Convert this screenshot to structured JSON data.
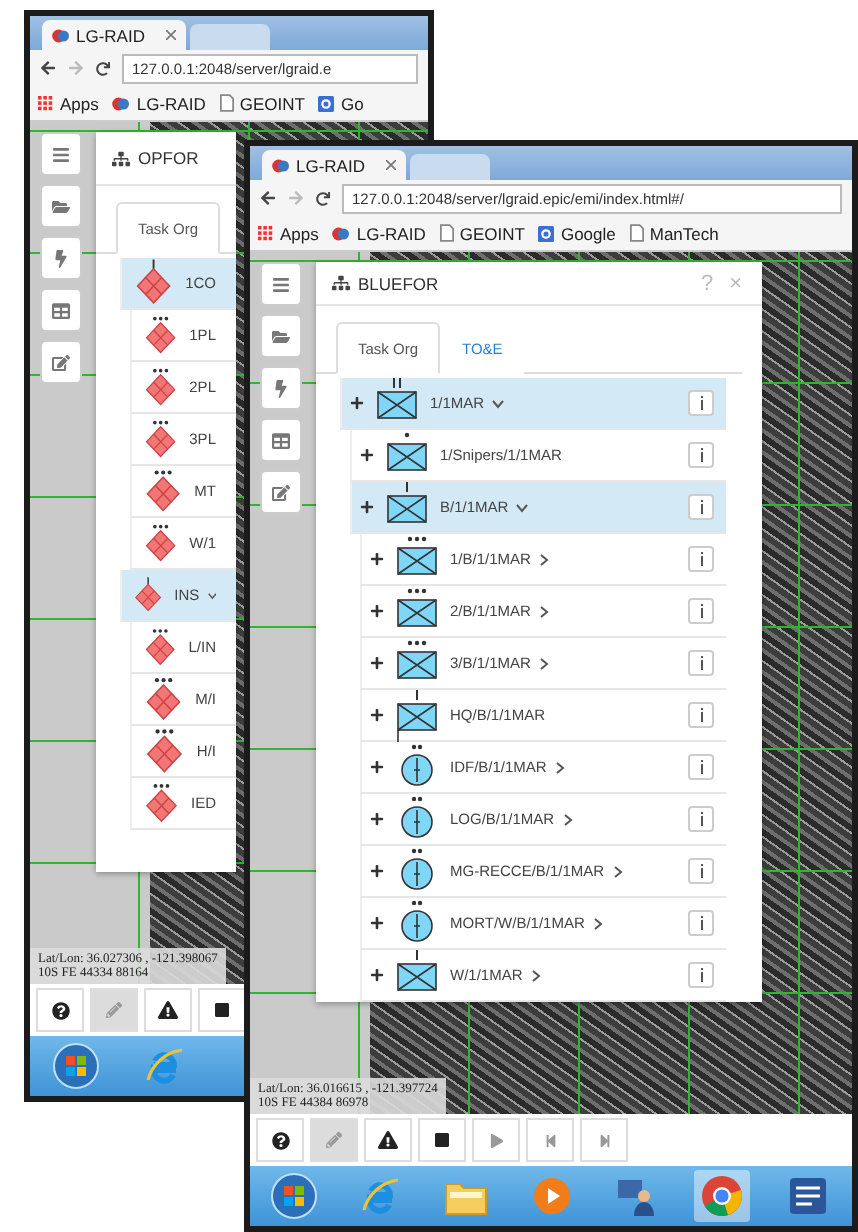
{
  "windows": [
    {
      "tab_title": "LG-RAID",
      "url": "127.0.0.1:2048/server/lgraid.e",
      "bookmarks": [
        {
          "label": "Apps",
          "kind": "apps"
        },
        {
          "label": "LG-RAID",
          "kind": "logo"
        },
        {
          "label": "GEOINT",
          "kind": "page"
        },
        {
          "label": "Go",
          "kind": "google"
        }
      ],
      "side_tools": [
        {
          "kind": "menu"
        },
        {
          "kind": "folder"
        },
        {
          "kind": "lightning"
        },
        {
          "kind": "table"
        },
        {
          "kind": "edit"
        }
      ],
      "panel": {
        "title": "OPFOR",
        "tabs": [
          {
            "label": "Task Org",
            "selected": true
          }
        ],
        "tree": [
          {
            "label": "1CO",
            "kind": "hostile-company",
            "expanded": true,
            "has_children": false,
            "children": [
              {
                "label": "1PL",
                "kind": "hostile-platoon",
                "expanded": false,
                "has_children": false
              },
              {
                "label": "2PL",
                "kind": "hostile-platoon",
                "expanded": false,
                "has_children": false
              },
              {
                "label": "3PL",
                "kind": "hostile-platoon",
                "expanded": false,
                "has_children": false
              },
              {
                "label": "MT",
                "kind": "hostile-platoon",
                "expanded": false,
                "has_children": false
              },
              {
                "label": "W/1",
                "kind": "hostile-platoon",
                "expanded": false,
                "has_children": false
              }
            ]
          },
          {
            "label": "INS",
            "kind": "hostile-company",
            "expanded": true,
            "has_children": true,
            "children": [
              {
                "label": "L/IN",
                "kind": "hostile-platoon",
                "expanded": false,
                "has_children": false
              },
              {
                "label": "M/I",
                "kind": "hostile-platoon",
                "expanded": false,
                "has_children": false
              },
              {
                "label": "H/I",
                "kind": "hostile-platoon",
                "expanded": false,
                "has_children": false
              },
              {
                "label": "IED",
                "kind": "hostile-platoon",
                "expanded": false,
                "has_children": false
              }
            ]
          }
        ]
      },
      "coordinates": [
        "Lat/Lon: 36.027306 , -121.398067",
        "10S FE 44334 88164"
      ],
      "tools": [
        {
          "kind": "help",
          "pressed": false
        },
        {
          "kind": "pencil",
          "pressed": true
        },
        {
          "kind": "warning",
          "pressed": false
        },
        {
          "kind": "stop",
          "pressed": false
        }
      ],
      "taskbar": [
        {
          "kind": "start",
          "active": false
        },
        {
          "kind": "ie",
          "active": false
        }
      ]
    },
    {
      "tab_title": "LG-RAID",
      "url": "127.0.0.1:2048/server/lgraid.epic/emi/index.html#/",
      "bookmarks": [
        {
          "label": "Apps",
          "kind": "apps"
        },
        {
          "label": "LG-RAID",
          "kind": "logo"
        },
        {
          "label": "GEOINT",
          "kind": "page"
        },
        {
          "label": "Google",
          "kind": "google"
        },
        {
          "label": "ManTech",
          "kind": "page"
        }
      ],
      "side_tools": [
        {
          "kind": "menu"
        },
        {
          "kind": "folder"
        },
        {
          "kind": "lightning"
        },
        {
          "kind": "table"
        },
        {
          "kind": "edit"
        }
      ],
      "panel": {
        "title": "BLUEFOR",
        "help": "?",
        "close": "×",
        "tabs": [
          {
            "label": "Task Org",
            "selected": true
          },
          {
            "label": "TO&E",
            "selected": false
          }
        ],
        "tree": [
          {
            "label": "1/1MAR",
            "kind": "infantry-battalion",
            "expanded": true,
            "has_children": true,
            "children": [
              {
                "label": "1/Snipers/1/1MAR",
                "kind": "infantry-squad",
                "expanded": false,
                "has_children": false
              },
              {
                "label": "B/1/1MAR",
                "kind": "infantry-company",
                "expanded": true,
                "has_children": true,
                "children": [
                  {
                    "label": "1/B/1/1MAR",
                    "kind": "infantry-platoon",
                    "expanded": false,
                    "has_children": true
                  },
                  {
                    "label": "2/B/1/1MAR",
                    "kind": "infantry-platoon",
                    "expanded": false,
                    "has_children": true
                  },
                  {
                    "label": "3/B/1/1MAR",
                    "kind": "infantry-platoon",
                    "expanded": false,
                    "has_children": true
                  },
                  {
                    "label": "HQ/B/1/1MAR",
                    "kind": "headquarters-company",
                    "expanded": false,
                    "has_children": false
                  },
                  {
                    "label": "IDF/B/1/1MAR",
                    "kind": "support-section",
                    "expanded": false,
                    "has_children": true
                  },
                  {
                    "label": "LOG/B/1/1MAR",
                    "kind": "support-section",
                    "expanded": false,
                    "has_children": true
                  },
                  {
                    "label": "MG-RECCE/B/1/1MAR",
                    "kind": "support-section",
                    "expanded": false,
                    "has_children": true
                  },
                  {
                    "label": "MORT/W/B/1/1MAR",
                    "kind": "support-section",
                    "expanded": false,
                    "has_children": true
                  },
                  {
                    "label": "W/1/1MAR",
                    "kind": "infantry-company",
                    "expanded": false,
                    "has_children": true
                  }
                ]
              }
            ]
          }
        ]
      },
      "coordinates": [
        "Lat/Lon: 36.016615 , -121.397724",
        "10S FE 44384 86978"
      ],
      "tools": [
        {
          "kind": "help",
          "pressed": false
        },
        {
          "kind": "pencil",
          "pressed": true
        },
        {
          "kind": "warning",
          "pressed": false
        },
        {
          "kind": "stop",
          "pressed": false
        },
        {
          "kind": "play",
          "pressed": false
        },
        {
          "kind": "skip-back",
          "pressed": false
        },
        {
          "kind": "skip-forward",
          "pressed": false
        }
      ],
      "taskbar": [
        {
          "kind": "start",
          "active": false
        },
        {
          "kind": "ie",
          "active": false
        },
        {
          "kind": "folder",
          "active": false
        },
        {
          "kind": "media",
          "active": false
        },
        {
          "kind": "network",
          "active": false
        },
        {
          "kind": "chrome",
          "active": true
        },
        {
          "kind": "word",
          "active": false
        }
      ]
    }
  ]
}
